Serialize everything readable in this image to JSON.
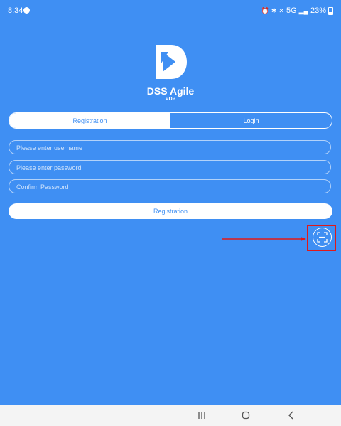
{
  "status_bar": {
    "time": "8:34",
    "network": "5G",
    "battery": "23%"
  },
  "app": {
    "title": "DSS Agile",
    "subtitle": "VDP"
  },
  "tabs": [
    {
      "label": "Registration",
      "active": true
    },
    {
      "label": "Login",
      "active": false
    }
  ],
  "form": {
    "username_placeholder": "Please enter username",
    "password_placeholder": "Please enter password",
    "confirm_placeholder": "Confirm Password",
    "submit_label": "Registration"
  },
  "icons": {
    "scan": "scan-qr-icon",
    "recents": "recent-apps-icon",
    "home": "home-icon",
    "back": "back-icon"
  },
  "colors": {
    "background": "#3f8ff3",
    "accent": "#ffffff",
    "highlight": "#e01919",
    "nav_bar": "#f4f4f4"
  }
}
